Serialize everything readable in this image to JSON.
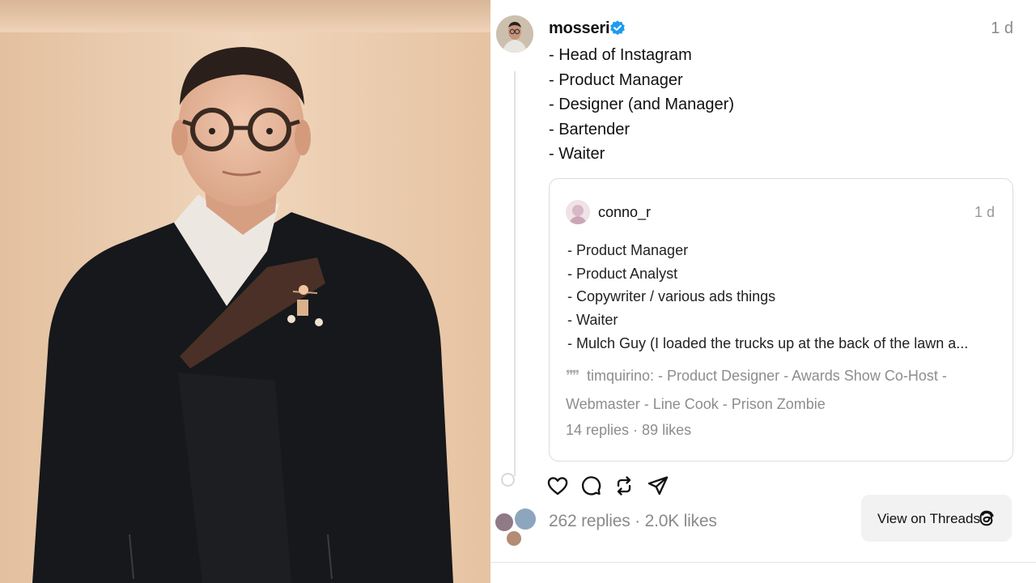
{
  "post": {
    "username": "mosseri",
    "verified_icon": "verified-badge-icon",
    "time": "1 d",
    "lines": [
      "- Head of Instagram",
      "- Product Manager",
      "- Designer (and Manager)",
      "- Bartender",
      "- Waiter"
    ],
    "stats": "262 replies · 2.0K likes"
  },
  "quote": {
    "username": "conno_r",
    "time": "1 d",
    "lines": [
      "- Product Manager",
      "- Product Analyst",
      "- Copywriter / various ads things",
      "- Waiter",
      "- Mulch Guy (I loaded the trucks up at the back of the lawn a..."
    ],
    "attribution_icon": "quote-icon",
    "attribution": "timquirino: - Product Designer - Awards Show Co-Host - Webmaster - Line Cook - Prison Zombie",
    "stats": "14 replies · 89 likes"
  },
  "actions": {
    "like": "heart-icon",
    "comment": "comment-icon",
    "repost": "repost-icon",
    "share": "send-icon"
  },
  "view_button": {
    "label": "View on Threads",
    "icon": "threads-logo-icon"
  },
  "colors": {
    "verified": "#1d9bf0",
    "muted_text": "#8a8a8a",
    "card_border": "#dcdcdc",
    "photo_background": "#e8c7a6",
    "suit": "#16181b"
  }
}
